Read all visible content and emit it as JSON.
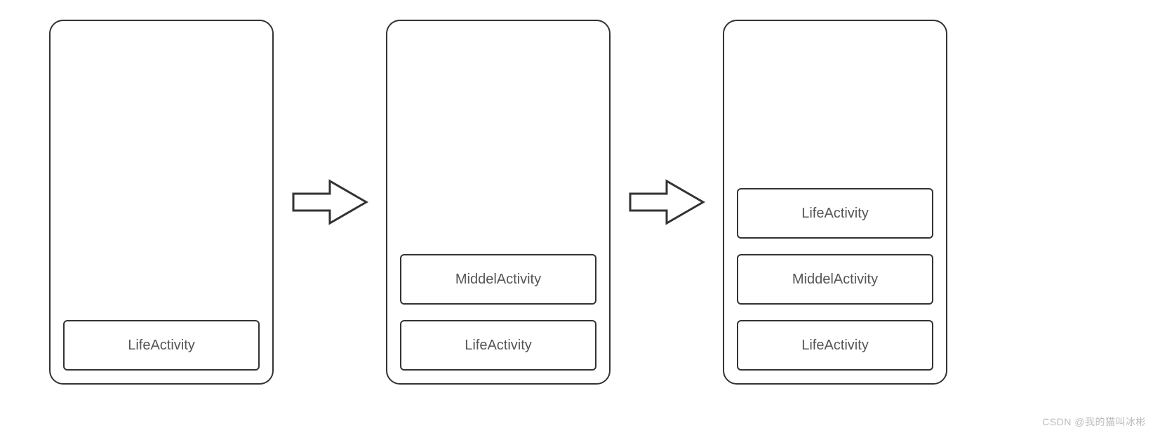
{
  "stacks": [
    {
      "items": [
        "LifeActivity"
      ]
    },
    {
      "items": [
        "MiddelActivity",
        "LifeActivity"
      ]
    },
    {
      "items": [
        "LifeActivity",
        "MiddelActivity",
        "LifeActivity"
      ]
    }
  ],
  "watermark": "CSDN @我的猫叫冰彬"
}
